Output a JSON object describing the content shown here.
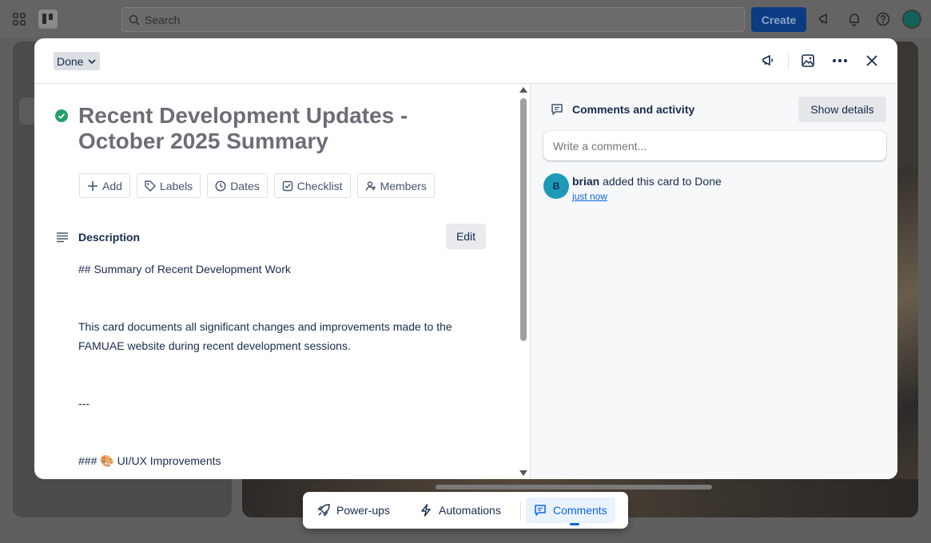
{
  "topbar": {
    "search_placeholder": "Search",
    "create_label": "Create"
  },
  "card": {
    "list_name": "Done",
    "title": "Recent Development Updates - October 2025 Summary",
    "actions": [
      {
        "label": "Add",
        "icon": "plus-icon"
      },
      {
        "label": "Labels",
        "icon": "tag-icon"
      },
      {
        "label": "Dates",
        "icon": "clock-icon"
      },
      {
        "label": "Checklist",
        "icon": "checklist-icon"
      },
      {
        "label": "Members",
        "icon": "add-member-icon"
      }
    ],
    "description": {
      "heading": "Description",
      "edit_label": "Edit",
      "lines": [
        "## Summary of Recent Development Work",
        "This card documents all significant changes and improvements made to the",
        "FAMUAE website during recent development sessions.",
        "---",
        "### 🎨 UI/UX Improvements"
      ]
    }
  },
  "activity": {
    "heading": "Comments and activity",
    "show_details_label": "Show details",
    "comment_placeholder": "Write a comment...",
    "entries": [
      {
        "avatar_initial": "B",
        "user": "brian",
        "text": " added this card to Done",
        "time": "just now"
      }
    ]
  },
  "bottom_bar": {
    "items": [
      {
        "label": "Power-ups",
        "icon": "rocket-icon"
      },
      {
        "label": "Automations",
        "icon": "lightning-icon"
      },
      {
        "label": "Comments",
        "icon": "comment-icon",
        "active": true
      }
    ]
  },
  "colors": {
    "accent": "#0c66e4",
    "done_green": "#22a06b",
    "avatar": "#1d9ab8"
  }
}
